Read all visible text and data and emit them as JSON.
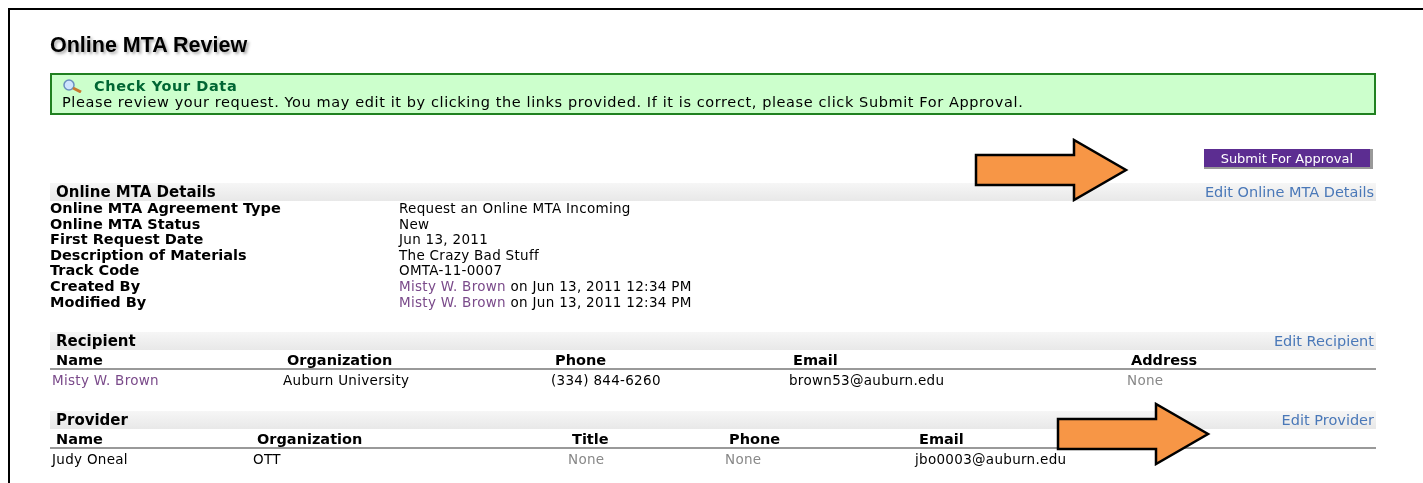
{
  "title": "Online MTA Review",
  "notice": {
    "title": "Check Your Data",
    "message": "Please review your request. You may edit it by clicking the links provided. If it is correct, please click Submit For Approval."
  },
  "submit_button": "Submit For Approval",
  "details": {
    "title": "Online MTA Details",
    "edit_link": "Edit Online MTA Details",
    "fields": [
      {
        "label": "Online MTA Agreement Type",
        "value": "Request an Online MTA Incoming"
      },
      {
        "label": "Online MTA Status",
        "value": "New"
      },
      {
        "label": "First Request Date",
        "value": "Jun 13, 2011"
      },
      {
        "label": "Description of Materials",
        "value": "The Crazy Bad Stuff"
      },
      {
        "label": "Track Code",
        "value": "OMTA-11-0007"
      },
      {
        "label": "Created By",
        "person": "Misty W. Brown",
        "value": "on Jun 13, 2011 12:34 PM"
      },
      {
        "label": "Modified By",
        "person": "Misty W. Brown",
        "value": "on Jun 13, 2011 12:34 PM"
      }
    ]
  },
  "recipient": {
    "title": "Recipient",
    "edit_link": "Edit Recipient",
    "columns": [
      "Name",
      "Organization",
      "Phone",
      "Email",
      "Address"
    ],
    "rows": [
      {
        "cells": [
          {
            "text": "Misty W. Brown",
            "kind": "link"
          },
          {
            "text": "Auburn University",
            "kind": "text"
          },
          {
            "text": "(334) 844-6260",
            "kind": "text"
          },
          {
            "text": "brown53@auburn.edu",
            "kind": "text"
          },
          {
            "text": "None",
            "kind": "none"
          }
        ]
      }
    ]
  },
  "provider": {
    "title": "Provider",
    "edit_link": "Edit Provider",
    "columns": [
      "Name",
      "Organization",
      "Title",
      "Phone",
      "Email"
    ],
    "rows": [
      {
        "cells": [
          {
            "text": "Judy Oneal",
            "kind": "text"
          },
          {
            "text": "OTT",
            "kind": "text"
          },
          {
            "text": "None",
            "kind": "none"
          },
          {
            "text": "None",
            "kind": "none"
          },
          {
            "text": "jbo0003@auburn.edu",
            "kind": "text"
          }
        ]
      }
    ]
  }
}
